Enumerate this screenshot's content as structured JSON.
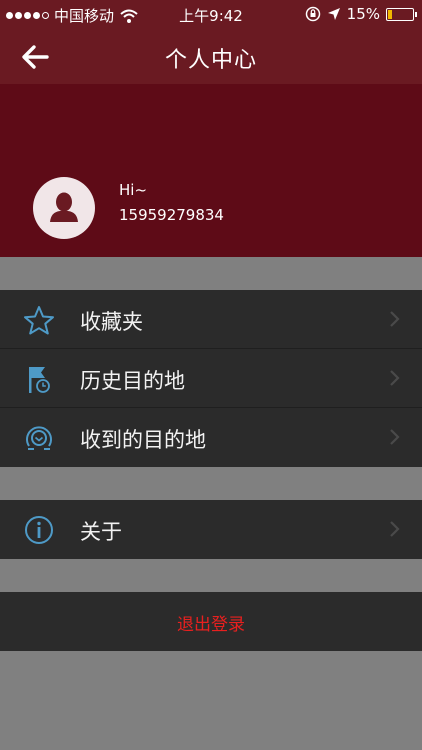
{
  "status_bar": {
    "carrier": "中国移动",
    "time": "上午9:42",
    "battery_percent": "15%",
    "battery_level": 0.15,
    "icons": [
      "signal-icon",
      "wifi-icon",
      "rotation-lock-icon",
      "location-arrow-icon",
      "battery-icon"
    ]
  },
  "nav": {
    "title": "个人中心",
    "back_icon": "back-arrow-icon"
  },
  "profile": {
    "greeting": "Hi~",
    "phone": "15959279834",
    "avatar_icon": "user-silhouette-icon"
  },
  "menu_group_1": [
    {
      "label": "收藏夹",
      "icon": "star-icon"
    },
    {
      "label": "历史目的地",
      "icon": "flag-clock-icon"
    },
    {
      "label": "收到的目的地",
      "icon": "received-destination-icon"
    }
  ],
  "menu_group_2": [
    {
      "label": "关于",
      "icon": "info-icon"
    }
  ],
  "logout": {
    "label": "退出登录"
  },
  "colors": {
    "header": "#6a1a22",
    "profile_bg": "#5e0b17",
    "menu_bg": "#2b2b2b",
    "page_bg": "#808080",
    "icon_accent": "#4e9ac7",
    "logout_text": "#e8201f"
  }
}
